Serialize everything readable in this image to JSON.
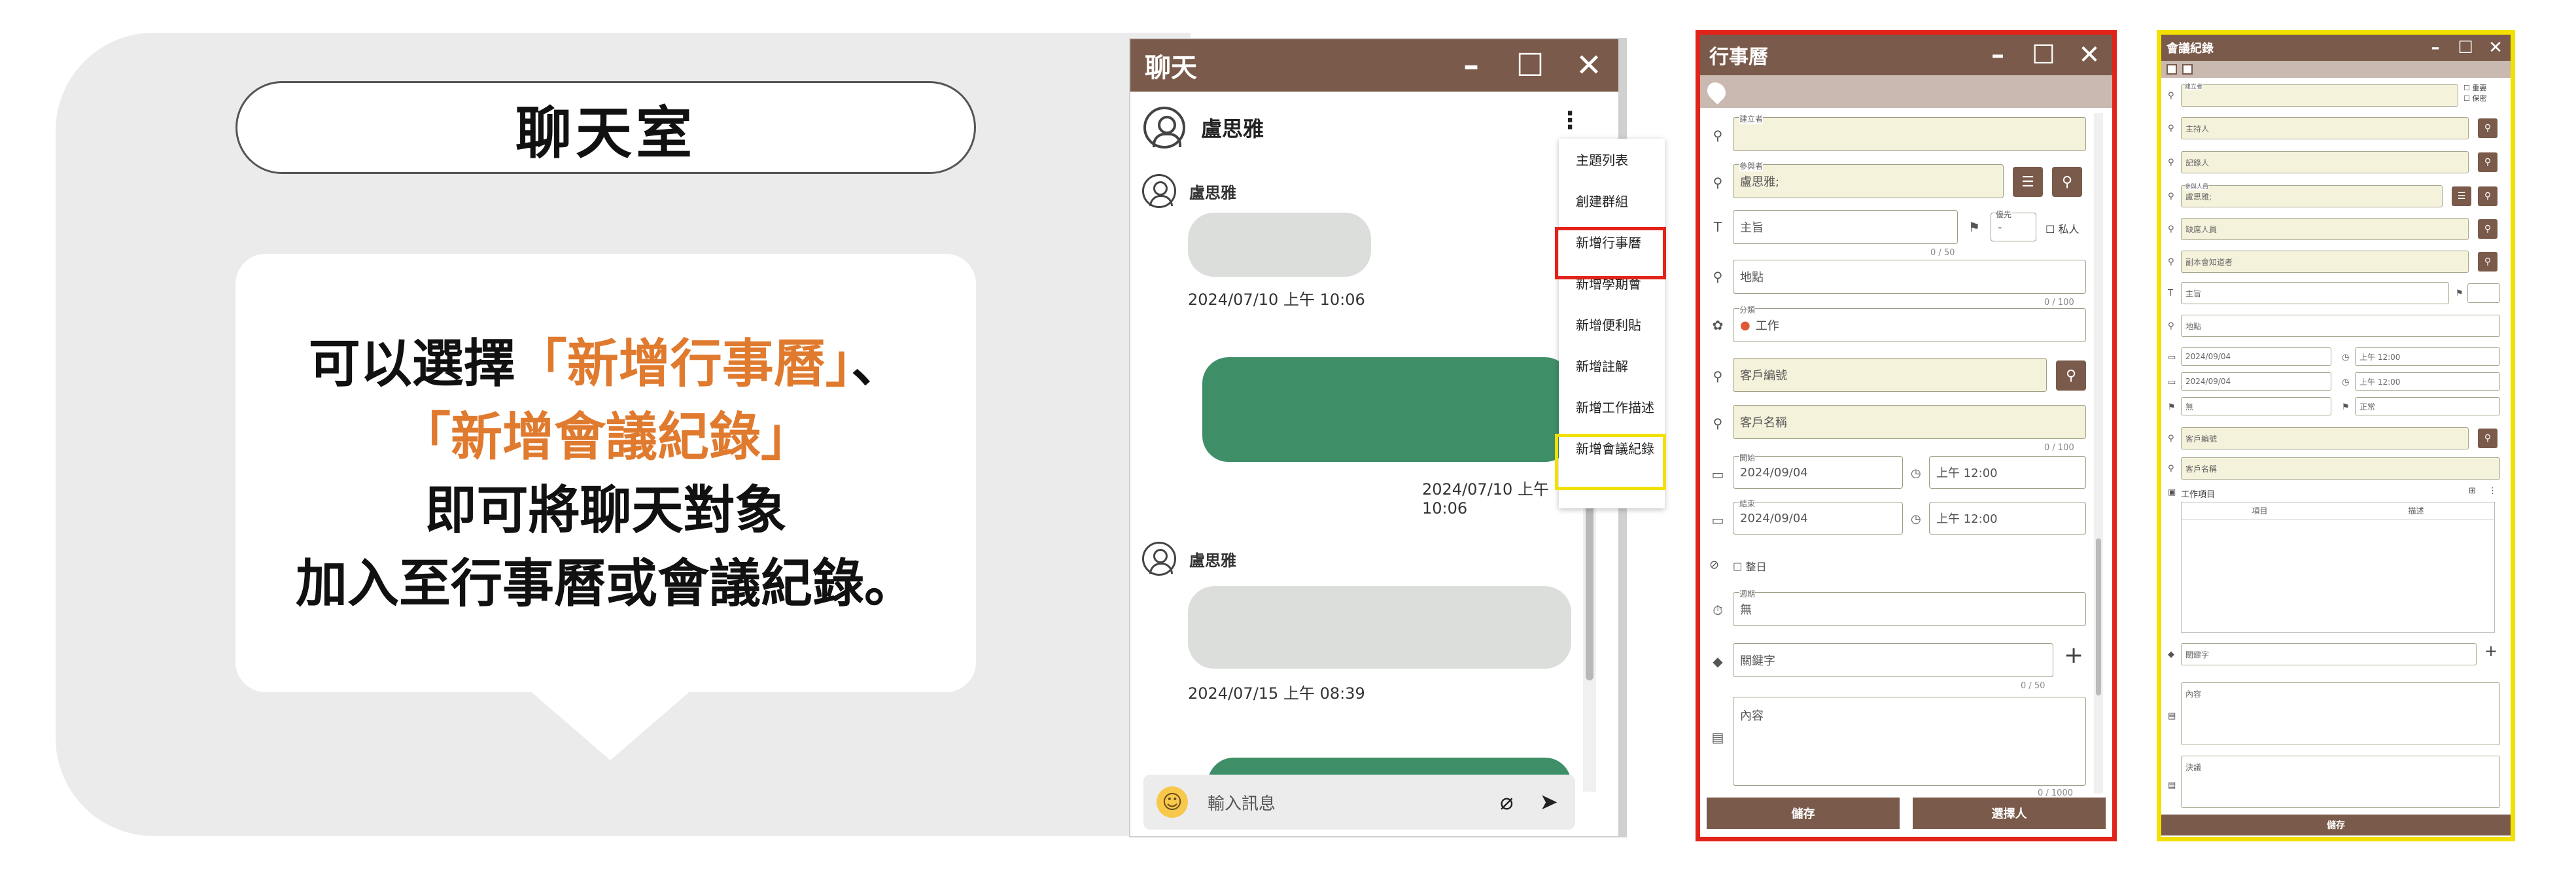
{
  "callout": {
    "title": "聊天室",
    "line1_a": "可以選擇",
    "line1_b": "「新增行事曆」",
    "line1_c": "、",
    "line2": "「新增會議紀錄」",
    "line3": "即可將聊天對象",
    "line4": "加入至行事曆或會議紀錄。",
    "highlight_color": "#e07a2e"
  },
  "chat": {
    "title": "聊天",
    "contact": "盧思雅",
    "messages": [
      {
        "sender": "盧思雅",
        "timestamp": "2024/07/10 上午 10:06"
      },
      {
        "sender": "",
        "timestamp": "2024/07/10 上午 10:06"
      },
      {
        "sender": "盧思雅",
        "timestamp": "2024/07/15 上午 08:39"
      }
    ],
    "input_placeholder": "輸入訊息",
    "menu": [
      "主題列表",
      "創建群組",
      "新增行事曆",
      "新增學期會",
      "新增便利貼",
      "新增註解",
      "新增工作描述",
      "新增會議紀錄"
    ],
    "accent": "#7a5a4a",
    "bubble_green": "#3e8f68"
  },
  "calendar": {
    "title": "行事曆",
    "organizer_label": "建立者",
    "participants_label": "參與者",
    "participants_value": "盧思雅;",
    "subject_ph": "主旨",
    "subject_counter": "0 / 50",
    "priority_label": "優先",
    "priority_value": "-",
    "private_label": "私人",
    "location_ph": "地點",
    "location_counter": "0 / 100",
    "category_label": "分類",
    "category_value": "工作",
    "client_code_ph": "客戶編號",
    "client_name_ph": "客戶名稱",
    "client_counter": "0 / 100",
    "start_label": "開始",
    "start_date": "2024/09/04",
    "start_time": "上午 12:00",
    "end_label": "結束",
    "end_date": "2024/09/04",
    "end_time": "上午 12:00",
    "allday_label": "整日",
    "repeat_label": "週期",
    "repeat_value": "無",
    "keyword_ph": "關鍵字",
    "keyword_counter": "0 / 50",
    "content_ph": "內容",
    "content_counter": "0 / 1000",
    "save": "儲存",
    "select_people": "選擇人"
  },
  "meeting": {
    "title": "會議紀錄",
    "check1": "重要",
    "check2": "保密",
    "organizer_label": "建立者",
    "host_ph": "主持人",
    "recorder_ph": "記錄人",
    "participants_label": "參與人員",
    "participants_value": "盧思雅;",
    "absent_ph": "缺席人員",
    "cc_ph": "副本會知道者",
    "subject_ph": "主旨",
    "location_ph": "地點",
    "start_date": "2024/09/04",
    "start_time": "上午 12:00",
    "end_date": "2024/09/04",
    "end_time": "上午 12:00",
    "repeat_label": "週期",
    "repeat_value": "無",
    "priority_label": "優先",
    "priority_value": "正常",
    "client_code_ph": "客戶編號",
    "client_name_ph": "客戶名稱",
    "work_items": "工作項目",
    "col1": "項目",
    "col2": "描述",
    "keyword_ph": "關鍵字",
    "content_ph": "內容",
    "resolution_ph": "決議",
    "save": "儲存"
  }
}
